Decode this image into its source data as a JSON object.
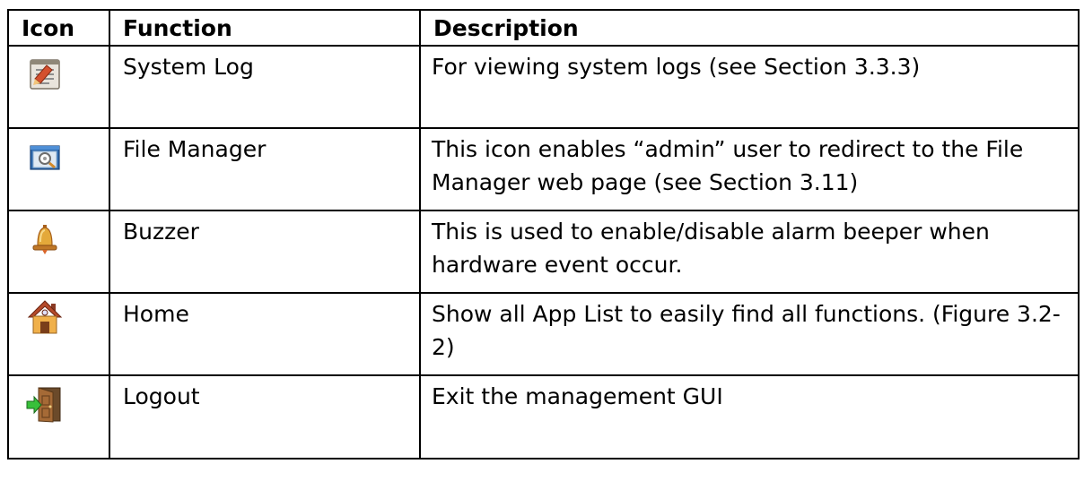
{
  "table": {
    "headers": {
      "icon": "Icon",
      "function": "Function",
      "description": "Description"
    },
    "rows": [
      {
        "icon": "system-log-icon",
        "function": "System Log",
        "description": "For viewing system logs (see Section 3.3.3)"
      },
      {
        "icon": "file-manager-icon",
        "function": "File Manager",
        "description": "This icon enables “admin” user to redirect to the File Manager web page (see Section 3.11)"
      },
      {
        "icon": "buzzer-bell-icon",
        "function": "Buzzer",
        "description": "This is used to enable/disable alarm beeper when hardware event occur."
      },
      {
        "icon": "home-icon",
        "function": "Home",
        "description": "Show all App List to easily find all functions. (Figure 3.2-2)"
      },
      {
        "icon": "logout-door-icon",
        "function": "Logout",
        "description": "Exit the management GUI"
      }
    ]
  }
}
